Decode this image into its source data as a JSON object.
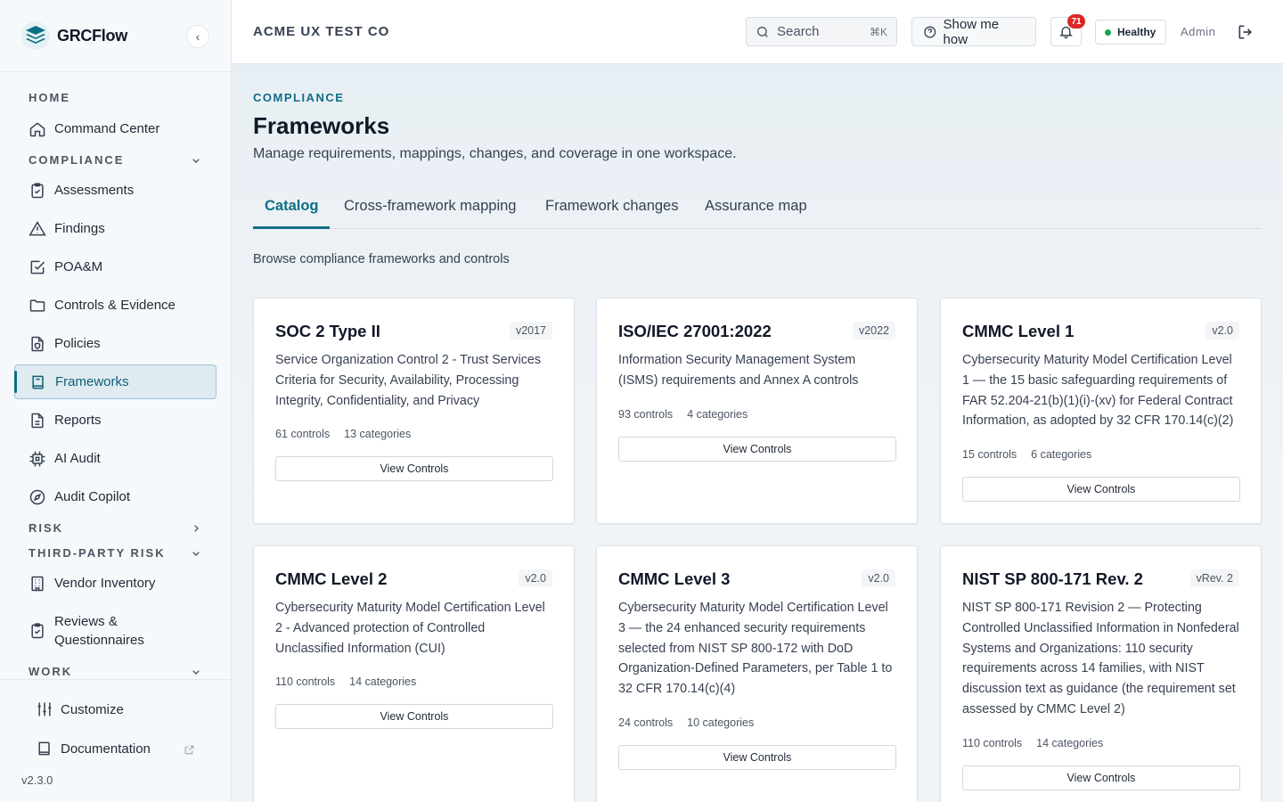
{
  "app": {
    "name": "GRCFlow",
    "collapse_icon": "‹"
  },
  "sidebar": {
    "sections": {
      "home": "HOME",
      "compliance": "COMPLIANCE",
      "risk": "RISK",
      "third_party_risk": "THIRD-PARTY RISK",
      "work": "WORK"
    },
    "items": {
      "command_center": "Command Center",
      "assessments": "Assessments",
      "findings": "Findings",
      "poam": "POA&M",
      "controls_evidence": "Controls & Evidence",
      "policies": "Policies",
      "frameworks": "Frameworks",
      "reports": "Reports",
      "ai_audit": "AI Audit",
      "audit_copilot": "Audit Copilot",
      "vendor_inventory": "Vendor Inventory",
      "reviews_line1": "Reviews &",
      "reviews_line2": "Questionnaires"
    },
    "footer": {
      "customize": "Customize",
      "documentation": "Documentation",
      "version": "v2.3.0"
    }
  },
  "topbar": {
    "org": "ACME UX TEST CO",
    "search_placeholder": "Search",
    "search_shortcut": "⌘K",
    "help_label": "Show me how",
    "notifications_count": "71",
    "health_label": "Healthy",
    "health_color": "#16a34a",
    "user_role": "Admin"
  },
  "page": {
    "eyebrow": "COMPLIANCE",
    "title": "Frameworks",
    "subtitle": "Manage requirements, mappings, changes, and coverage in one workspace.",
    "tabs": [
      "Catalog",
      "Cross-framework mapping",
      "Framework changes",
      "Assurance map"
    ],
    "active_tab": "Catalog",
    "tab_description": "Browse compliance frameworks and controls"
  },
  "frameworks": [
    {
      "title": "SOC 2 Type II",
      "version": "v2017",
      "description": "Service Organization Control 2 - Trust Services Criteria for Security, Availability, Processing Integrity, Confidentiality, and Privacy",
      "controls": "61 controls",
      "categories": "13 categories",
      "button": "View Controls"
    },
    {
      "title": "ISO/IEC 27001:2022",
      "version": "v2022",
      "description": "Information Security Management System (ISMS) requirements and Annex A controls",
      "controls": "93 controls",
      "categories": "4 categories",
      "button": "View Controls"
    },
    {
      "title": "CMMC Level 1",
      "version": "v2.0",
      "description": "Cybersecurity Maturity Model Certification Level 1 — the 15 basic safeguarding requirements of FAR 52.204-21(b)(1)(i)-(xv) for Federal Contract Information, as adopted by 32 CFR 170.14(c)(2)",
      "controls": "15 controls",
      "categories": "6 categories",
      "button": "View Controls"
    },
    {
      "title": "CMMC Level 2",
      "version": "v2.0",
      "description": "Cybersecurity Maturity Model Certification Level 2 - Advanced protection of Controlled Unclassified Information (CUI)",
      "controls": "110 controls",
      "categories": "14 categories",
      "button": "View Controls"
    },
    {
      "title": "CMMC Level 3",
      "version": "v2.0",
      "description": "Cybersecurity Maturity Model Certification Level 3 — the 24 enhanced security requirements selected from NIST SP 800-172 with DoD Organization-Defined Parameters, per Table 1 to 32 CFR 170.14(c)(4)",
      "controls": "24 controls",
      "categories": "10 categories",
      "button": "View Controls"
    },
    {
      "title": "NIST SP 800-171 Rev. 2",
      "version": "vRev. 2",
      "description": "NIST SP 800-171 Revision 2 — Protecting Controlled Unclassified Information in Nonfederal Systems and Organizations: 110 security requirements across 14 families, with NIST discussion text as guidance (the requirement set assessed by CMMC Level 2)",
      "controls": "110 controls",
      "categories": "14 categories",
      "button": "View Controls"
    }
  ],
  "colors": {
    "accent": "#0e6e86",
    "badge": "#dc2626"
  }
}
